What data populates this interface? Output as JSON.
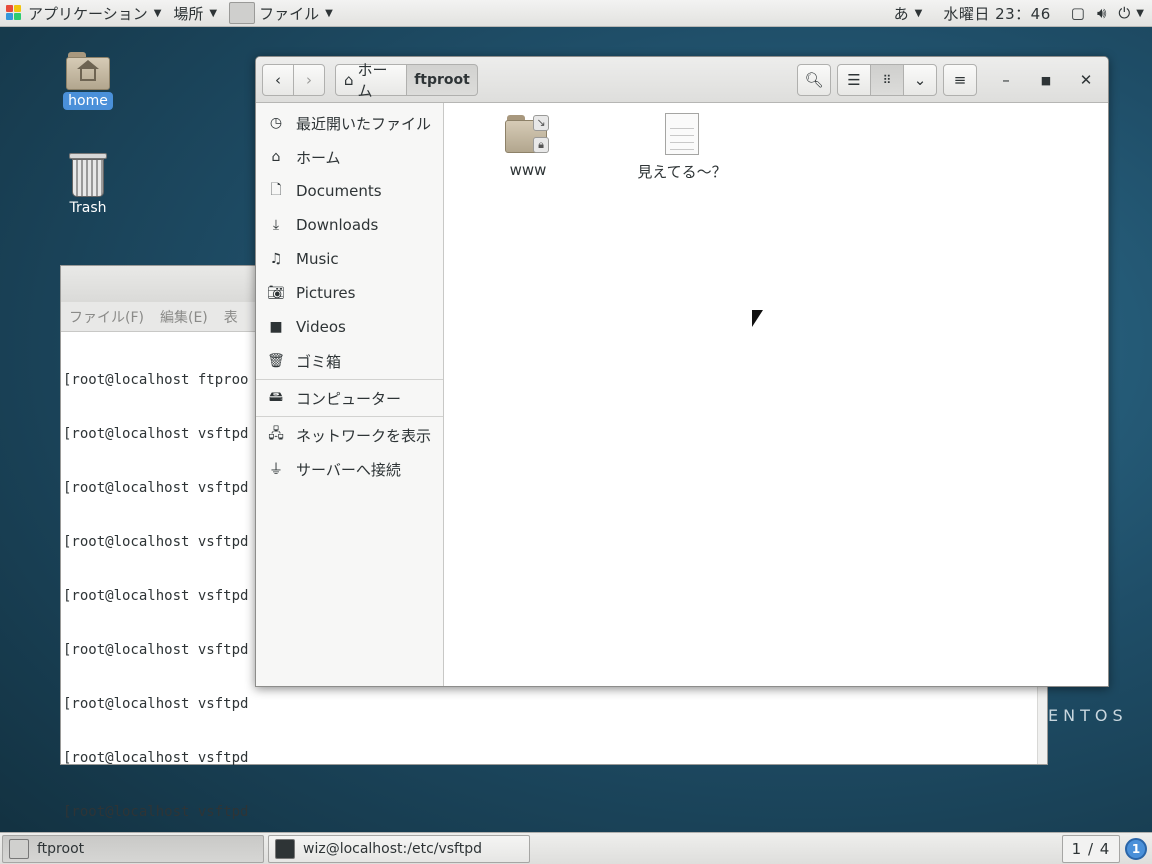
{
  "topbar": {
    "apps_label": "アプリケーション",
    "places_label": "場所",
    "app_menu_label": "ファイル",
    "input_method": "あ",
    "clock": "水曜日 23：46"
  },
  "desktop": {
    "home_label": "home",
    "trash_label": "Trash"
  },
  "terminal": {
    "menu": [
      "ファイル(F)",
      "編集(E)",
      "表"
    ],
    "lines": [
      "[root@localhost ftproo",
      "[root@localhost vsftpd",
      "[root@localhost vsftpd",
      "[root@localhost vsftpd",
      "[root@localhost vsftpd",
      "[root@localhost vsftpd",
      "[root@localhost vsftpd",
      "[root@localhost vsftpd",
      "[root@localhost vsftpd"
    ],
    "watermark": "ENTOS"
  },
  "filemanager": {
    "breadcrumb_home": "ホーム",
    "breadcrumb_current": "ftproot",
    "sidebar": [
      {
        "label": "最近開いたファイル",
        "icon": "clock-icon"
      },
      {
        "label": "ホーム",
        "icon": "home-icon"
      },
      {
        "label": "Documents",
        "icon": "document-icon"
      },
      {
        "label": "Downloads",
        "icon": "download-icon"
      },
      {
        "label": "Music",
        "icon": "music-icon"
      },
      {
        "label": "Pictures",
        "icon": "camera-icon"
      },
      {
        "label": "Videos",
        "icon": "video-icon"
      },
      {
        "label": "ゴミ箱",
        "icon": "trash-icon"
      },
      {
        "label": "コンピューター",
        "icon": "computer-icon"
      },
      {
        "label": "ネットワークを表示",
        "icon": "network-icon"
      },
      {
        "label": "サーバーへ接続",
        "icon": "server-icon"
      }
    ],
    "files": [
      {
        "name": "www",
        "type": "folder-link-locked"
      },
      {
        "name": "見えてる～？",
        "type": "text-document"
      }
    ]
  },
  "taskbar": {
    "tasks": [
      {
        "label": "ftproot",
        "active": true
      },
      {
        "label": "wiz@localhost:/etc/vsftpd",
        "active": false
      }
    ],
    "workspace": "1 / 4",
    "notification_count": "1"
  },
  "colors": {
    "accent": "#4a90d9",
    "desktop_bg": "#1f4e68"
  }
}
